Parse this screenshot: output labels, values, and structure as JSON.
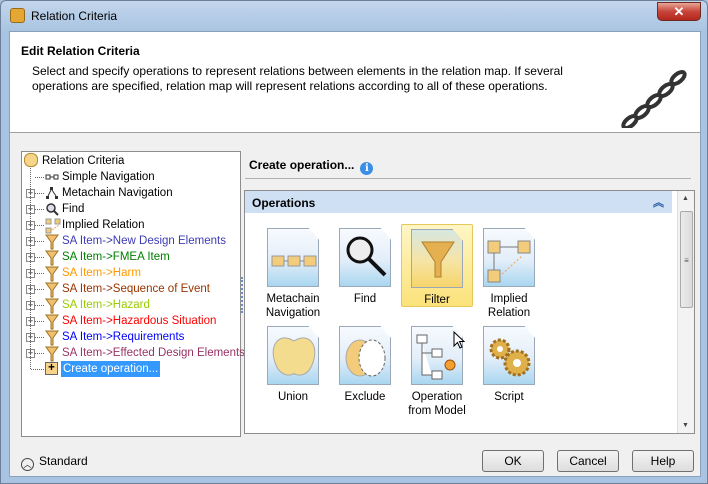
{
  "window": {
    "title": "Relation Criteria",
    "close": "✕"
  },
  "header": {
    "title": "Edit Relation Criteria",
    "description": "Select and specify operations to represent relations between elements in the relation map. If several operations are specified, relation map will represent relations according to all of these operations."
  },
  "tree": {
    "root": "Relation Criteria",
    "items": [
      {
        "label": "Simple Navigation",
        "color": "#000000",
        "icon": "simple-navigation-icon",
        "expandable": false
      },
      {
        "label": "Metachain Navigation",
        "color": "#000000",
        "icon": "metachain-icon",
        "expandable": true
      },
      {
        "label": "Find",
        "color": "#000000",
        "icon": "find-icon",
        "expandable": true
      },
      {
        "label": "Implied Relation",
        "color": "#000000",
        "icon": "implied-relation-icon",
        "expandable": true
      },
      {
        "label": "SA Item->New Design Elements",
        "color": "#3b3bb8",
        "icon": "filter-icon",
        "expandable": true
      },
      {
        "label": "SA Item->FMEA Item",
        "color": "#008000",
        "icon": "filter-icon",
        "expandable": true
      },
      {
        "label": "SA Item->Harm",
        "color": "#ff9900",
        "icon": "filter-icon",
        "expandable": true
      },
      {
        "label": "SA Item->Sequence of Event",
        "color": "#993300",
        "icon": "filter-icon",
        "expandable": true
      },
      {
        "label": "SA Item->Hazard",
        "color": "#99cc00",
        "icon": "filter-icon",
        "expandable": true
      },
      {
        "label": "SA Item->Hazardous Situation",
        "color": "#ff0000",
        "icon": "filter-icon",
        "expandable": true
      },
      {
        "label": "SA Item->Requirements",
        "color": "#0000ff",
        "icon": "filter-icon",
        "expandable": true
      },
      {
        "label": "SA Item->Effected Design Elements",
        "color": "#993366",
        "icon": "filter-icon",
        "expandable": true
      }
    ],
    "create": "Create operation..."
  },
  "right": {
    "title": "Create operation...",
    "section": "Operations",
    "tiles": [
      {
        "l1": "Metachain",
        "l2": "Navigation"
      },
      {
        "l1": "Find",
        "l2": ""
      },
      {
        "l1": "Filter",
        "l2": ""
      },
      {
        "l1": "Implied",
        "l2": "Relation"
      },
      {
        "l1": "Union",
        "l2": ""
      },
      {
        "l1": "Exclude",
        "l2": ""
      },
      {
        "l1": "Operation",
        "l2": "from Model"
      },
      {
        "l1": "Script",
        "l2": ""
      }
    ]
  },
  "footer": {
    "mode": "Standard",
    "ok": "OK",
    "cancel": "Cancel",
    "help": "Help"
  }
}
